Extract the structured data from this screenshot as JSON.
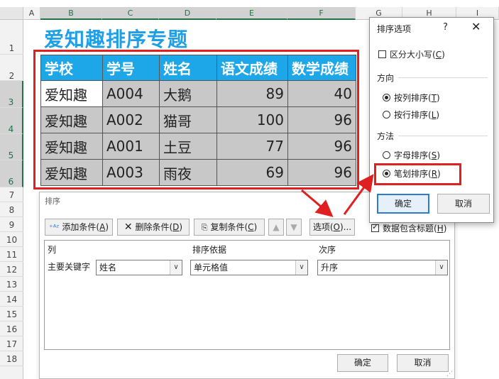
{
  "sheet": {
    "columns": [
      "A",
      "B",
      "C",
      "D",
      "E",
      "F",
      "G",
      "H",
      "I"
    ],
    "rows": [
      "1",
      "2",
      "3",
      "4",
      "5",
      "6",
      "7",
      "8",
      "9",
      "10",
      "11",
      "12",
      "13",
      "14",
      "15",
      "16",
      "17",
      "18"
    ],
    "title": "爱知趣排序专题",
    "headers": [
      "学校",
      "学号",
      "姓名",
      "语文成绩",
      "数学成绩"
    ],
    "data": [
      [
        "爱知趣",
        "A004",
        "大鹅",
        "89",
        "40"
      ],
      [
        "爱知趣",
        "A002",
        "猫哥",
        "100",
        "96"
      ],
      [
        "爱知趣",
        "A001",
        "土豆",
        "77",
        "96"
      ],
      [
        "爱知趣",
        "A003",
        "雨夜",
        "69",
        "96"
      ]
    ]
  },
  "sort_dialog": {
    "title": "排序",
    "add_label": "添加条件(",
    "add_key": "A",
    "delete_label": "删除条件(",
    "delete_key": "D",
    "copy_label": "复制条件(",
    "copy_key": "C",
    "options_label": "选项(",
    "options_key": "O",
    "options_suffix": ")...",
    "has_header_label": "数据包含标题(",
    "has_header_key": "H",
    "col_header": "列",
    "sort_on_header": "排序依据",
    "order_header": "次序",
    "row_label": "主要关键字",
    "column_value": "姓名",
    "sort_on_value": "单元格值",
    "order_value": "升序",
    "ok": "确定",
    "cancel": "取消"
  },
  "options_dialog": {
    "title": "排序选项",
    "help": "?",
    "case_label": "区分大小写(",
    "case_key": "C",
    "direction_label": "方向",
    "by_column_label": "按列排序(",
    "by_column_key": "T",
    "by_row_label": "按行排序(",
    "by_row_key": "L",
    "method_label": "方法",
    "letter_label": "字母排序(",
    "letter_key": "S",
    "stroke_label": "笔划排序(",
    "stroke_key": "R",
    "ok": "确定",
    "cancel": "取消"
  },
  "colors": {
    "accent": "#1da6e8",
    "highlight": "#e02020",
    "excel_green": "#217346"
  }
}
